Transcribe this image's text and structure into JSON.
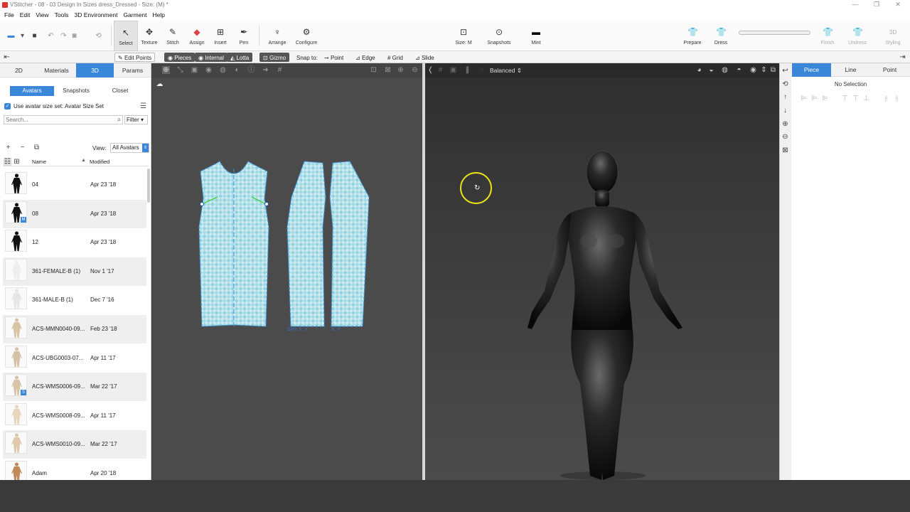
{
  "title": "VStitcher - 08 - 03 Design In Sizes dress_Dressed - Size: (M) *",
  "menu": [
    "File",
    "Edit",
    "View",
    "Tools",
    "3D Environment",
    "Garment",
    "Help"
  ],
  "tools": {
    "select": "Select",
    "texture": "Texture",
    "stitch": "Stitch",
    "assign": "Assign",
    "insert": "Insert",
    "pen": "Pen",
    "arrange": "Arrange",
    "configure": "Configure",
    "size": "Size: M",
    "snapshots": "Snapshots",
    "mint": "Mint",
    "prepare": "Prepare",
    "dress": "Dress",
    "finish": "Finish",
    "undress": "Undress",
    "styling": "Styling",
    "styling_top": "3D"
  },
  "subbar": {
    "edit_points": "Edit Points",
    "pieces": "Pieces",
    "internal": "Internal",
    "lotta": "Lotta",
    "gizmo": "Gizmo",
    "snap_to": "Snap to:",
    "point": "Point",
    "edge": "Edge",
    "grid": "Grid",
    "slide": "Slide"
  },
  "left": {
    "tabs": [
      "2D",
      "Materials",
      "3D",
      "Params"
    ],
    "subtabs": [
      "Avatars",
      "Snapshots",
      "Closet"
    ],
    "avatar_set": "Use avatar size set: Avatar Size Set",
    "search_placeholder": "Search...",
    "filter": "Filter",
    "view_label": "View:",
    "view_value": "All Avatars",
    "col_name": "Name",
    "col_modified": "Modified",
    "rows": [
      {
        "name": "04",
        "date": "Apr 23 '18",
        "badge": ""
      },
      {
        "name": "08",
        "date": "Apr 23 '18",
        "badge": "M"
      },
      {
        "name": "12",
        "date": "Apr 23 '18",
        "badge": ""
      },
      {
        "name": "361-FEMALE-B (1)",
        "date": "Nov 1 '17",
        "badge": ""
      },
      {
        "name": "361-MALE-B (1)",
        "date": "Dec 7 '16",
        "badge": ""
      },
      {
        "name": "ACS-MMN0040-09...",
        "date": "Feb 23 '18",
        "badge": ""
      },
      {
        "name": "ACS-UBG0003-07...",
        "date": "Apr 11 '17",
        "badge": ""
      },
      {
        "name": "ACS-WMS0006-09...",
        "date": "Mar 22 '17",
        "badge": "S"
      },
      {
        "name": "ACS-WMS0008-09...",
        "date": "Apr 11 '17",
        "badge": ""
      },
      {
        "name": "ACS-WMS0010-09...",
        "date": "Mar 22 '17",
        "badge": ""
      },
      {
        "name": "Adam",
        "date": "Apr 20 '18",
        "badge": ""
      }
    ]
  },
  "view2d": {
    "piece_label_1": "Sym X, Y",
    "piece_label_2": "X, Y"
  },
  "view3d": {
    "quality": "Balanced"
  },
  "right": {
    "tabs": [
      "Piece",
      "Line",
      "Point"
    ],
    "status": "No Selection"
  }
}
